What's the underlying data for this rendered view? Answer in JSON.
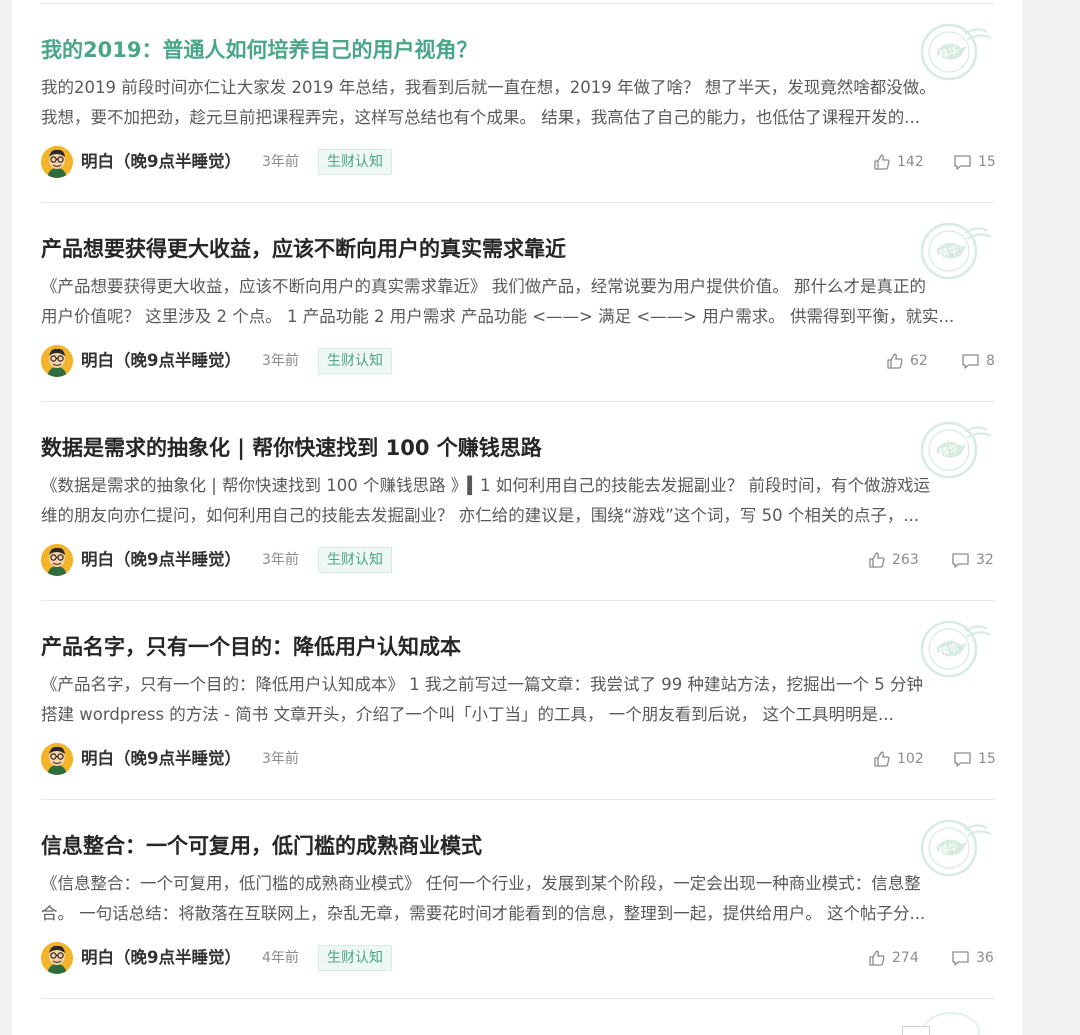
{
  "posts": [
    {
      "title": "我的2019：普通人如何培养自己的用户视角？",
      "featured_title": true,
      "excerpt_line1": "我的2019 前段时间亦仁让大家发 2019 年总结，我看到后就一直在想，2019 年做了啥？ 想了半天，发现竟然啥都没做。",
      "excerpt_line2": "我想，要不加把劲，趁元旦前把课程弄完，这样写总结也有个成果。 结果，我高估了自己的能力，也低估了课程开发的...",
      "author": "明白（晚9点半睡觉）",
      "time": "3年前",
      "tag": "生财认知",
      "likes": "142",
      "comments": "15",
      "badge_text": "精华"
    },
    {
      "title": "产品想要获得更大收益，应该不断向用户的真实需求靠近",
      "featured_title": false,
      "excerpt_line1": "《产品想要获得更大收益，应该不断向用户的真实需求靠近》 我们做产品，经常说要为用户提供价值。 那什么才是真正的",
      "excerpt_line2": "用户价值呢？ 这里涉及 2 个点。 1 产品功能 2 用户需求 产品功能 <——> 满足 <——> 用户需求。 供需得到平衡，就实...",
      "author": "明白（晚9点半睡觉）",
      "time": "3年前",
      "tag": "生财认知",
      "likes": "62",
      "comments": "8",
      "badge_text": "精华"
    },
    {
      "title": "数据是需求的抽象化 | 帮你快速找到 100 个赚钱思路",
      "featured_title": false,
      "excerpt_line1": "《数据是需求的抽象化 | 帮你快速找到 100 个赚钱思路 》▍1 如何利用自己的技能去发掘副业？ 前段时间，有个做游戏运",
      "excerpt_line2": "维的朋友向亦仁提问，如何利用自己的技能去发掘副业？ 亦仁给的建议是，围绕“游戏”这个词，写 50 个相关的点子，...",
      "author": "明白（晚9点半睡觉）",
      "time": "3年前",
      "tag": "生财认知",
      "likes": "263",
      "comments": "32",
      "badge_text": "精华"
    },
    {
      "title": "产品名字，只有一个目的：降低用户认知成本",
      "featured_title": false,
      "excerpt_line1": "《产品名字，只有一个目的：降低用户认知成本》 1 我之前写过一篇文章：我尝试了 99 种建站方法，挖掘出一个 5 分钟",
      "excerpt_line2": "搭建 wordpress 的方法 - 简书 文章开头，介绍了一个叫「小丁当」的工具， 一个朋友看到后说， 这个工具明明是...",
      "author": "明白（晚9点半睡觉）",
      "time": "3年前",
      "tag": "",
      "likes": "102",
      "comments": "15",
      "badge_text": "精华"
    },
    {
      "title": "信息整合：一个可复用，低门槛的成熟商业模式",
      "featured_title": false,
      "excerpt_line1": "《信息整合：一个可复用，低门槛的成熟商业模式》 任何一个行业，发展到某个阶段，一定会出现一种商业模式：信息整",
      "excerpt_line2": "合。 一句话总结：将散落在互联网上，杂乱无章，需要花时间才能看到的信息，整理到一起，提供给用户。 这个帖子分...",
      "author": "明白（晚9点半睡觉）",
      "time": "4年前",
      "tag": "生财认知",
      "likes": "274",
      "comments": "36",
      "badge_text": "精华"
    }
  ],
  "colors": {
    "accent": "#4aa686",
    "title": "#262626",
    "muted": "#8c8c8c"
  },
  "icons": {
    "like": "thumbs-up-icon",
    "comment": "comment-icon",
    "avatar": "avatar-cartoon",
    "badge": "featured-stamp-icon"
  }
}
